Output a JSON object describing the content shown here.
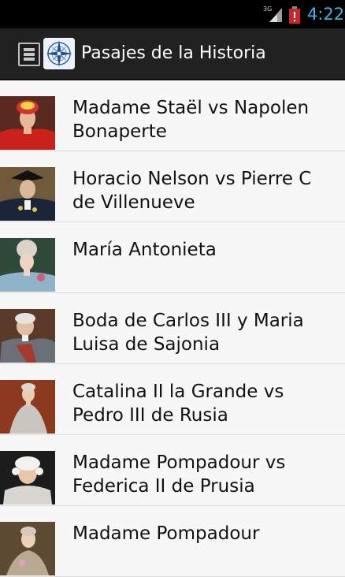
{
  "status": {
    "network": "3G",
    "time": "4:22"
  },
  "toolbar": {
    "title": "Pasajes de la Historia",
    "menu_icon": "hamburger-icon",
    "logo_icon": "compass-rose-icon"
  },
  "items": [
    {
      "label": "Madame Staël vs Napolen Bonaperte",
      "thumb": "portrait-woman-turban-red"
    },
    {
      "label": "Horacio Nelson vs Pierre C de Villenueve",
      "thumb": "portrait-man-naval-uniform"
    },
    {
      "label": "María Antonieta",
      "thumb": "portrait-woman-powdered-wig"
    },
    {
      "label": "Boda de Carlos III y Maria Luisa de Sajonia",
      "thumb": "portrait-man-armour"
    },
    {
      "label": "Catalina II la Grande vs Pedro III de Rusia",
      "thumb": "portrait-woman-silver-gown"
    },
    {
      "label": "Madame Pompadour vs Federica II de Prusia",
      "thumb": "portrait-man-white-wig"
    },
    {
      "label": "Madame Pompadour",
      "thumb": "portrait-woman-gown"
    }
  ],
  "colors": {
    "status_time": "#3fb4e3",
    "battery": "#c62828",
    "actionbar": "#212121",
    "list_background": "#f7f7f7"
  }
}
